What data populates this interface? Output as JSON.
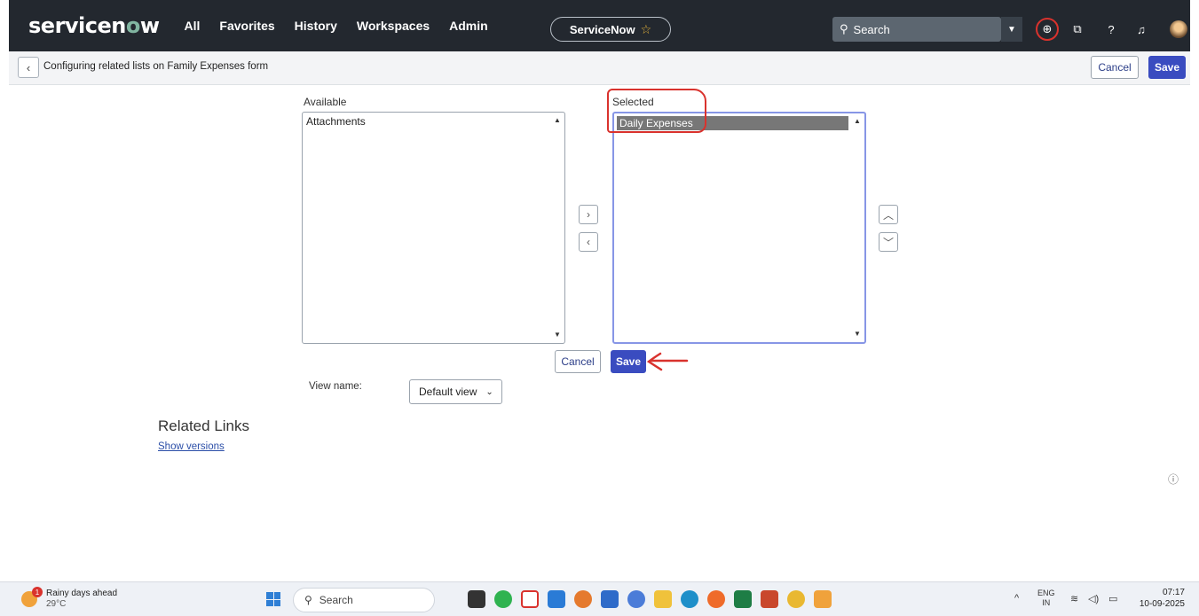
{
  "topnav": {
    "logo_prefix": "servicen",
    "logo_o": "o",
    "logo_suffix": "w",
    "links": [
      "All",
      "Favorites",
      "History",
      "Workspaces",
      "Admin"
    ],
    "instance_pill": "ServiceNow",
    "search_placeholder": "Search"
  },
  "header": {
    "title": "Configuring related lists on Family Expenses form",
    "cancel_label": "Cancel",
    "save_label": "Save"
  },
  "slushbucket": {
    "available_label": "Available",
    "available_items": [
      "Attachments"
    ],
    "selected_label": "Selected",
    "selected_items": [
      "Daily Expenses"
    ],
    "cancel_label": "Cancel",
    "save_label": "Save"
  },
  "view": {
    "label": "View name:",
    "selected_value": "Default view"
  },
  "related_links": {
    "title": "Related Links",
    "show_versions": "Show versions"
  },
  "taskbar": {
    "weather_line1": "Rainy days ahead",
    "weather_line2": "29°C",
    "weather_badge": "1",
    "search_label": "Search",
    "lang_line1": "ENG",
    "lang_line2": "IN",
    "time": "07:17",
    "date": "10-09-2025"
  },
  "colors": {
    "nav_bg": "#23282f",
    "primary_button": "#3a4cc0",
    "annotation_red": "#d9322d"
  }
}
